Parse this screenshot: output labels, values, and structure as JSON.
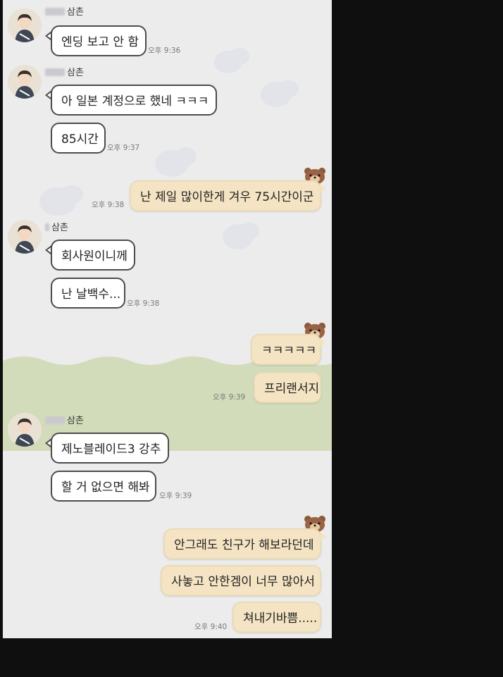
{
  "chat": {
    "messages": [
      {
        "sender": "삼촌",
        "text": "엔딩 보고 안 함",
        "time": "오후 9:36"
      },
      {
        "sender": "삼촌",
        "text": "아 일본 계정으로 했네 ㅋㅋㅋ",
        "time": ""
      },
      {
        "sender": "",
        "text": "85시간",
        "time": "오후 9:37"
      },
      {
        "sender": "me",
        "text": "난 제일 많이한게 겨우 75시간이군",
        "time": "오후 9:38"
      },
      {
        "sender": "삼촌",
        "text": "회사원이니께",
        "time": ""
      },
      {
        "sender": "",
        "text": "난 날백수...",
        "time": "오후 9:38"
      },
      {
        "sender": "me",
        "text": "ㅋㅋㅋㅋㅋ",
        "time": ""
      },
      {
        "sender": "me",
        "text": "프리랜서지",
        "time": "오후 9:39"
      },
      {
        "sender": "삼촌",
        "text": "제노블레이드3 강추",
        "time": ""
      },
      {
        "sender": "",
        "text": "할 거 없으면 해봐",
        "time": "오후 9:39"
      },
      {
        "sender": "me",
        "text": "안그래도 친구가 해보라던데",
        "time": ""
      },
      {
        "sender": "me",
        "text": "사놓고 안한겜이 너무 많아서",
        "time": ""
      },
      {
        "sender": "me",
        "text": "쳐내기바쁨.....",
        "time": "오후 9:40"
      }
    ]
  },
  "colors": {
    "page_background": "#0f0f0f",
    "chat_background": "#ececec",
    "green_band": "#d3dcba",
    "incoming_bubble": "#ffffff",
    "incoming_border": "#4c4c4c",
    "outgoing_bubble": "#f4e4c3"
  },
  "icons": {
    "avatar": "avatar-character",
    "my_avatar": "bear-face-icon",
    "cloud": "cloud-icon"
  }
}
